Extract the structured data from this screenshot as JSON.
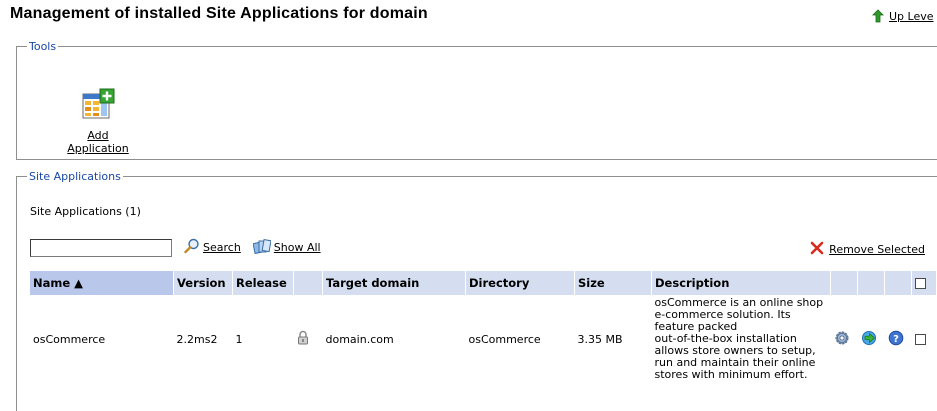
{
  "page": {
    "title": "Management of installed Site Applications for domain",
    "up_level": "Up Leve"
  },
  "tools": {
    "legend": "Tools",
    "add_application": "Add Application"
  },
  "site_apps": {
    "legend": "Site Applications",
    "count_label": "Site Applications (1)",
    "search_value": "",
    "search_label": "Search",
    "show_all_label": "Show All",
    "remove_selected_label": "Remove Selected",
    "columns": {
      "name": "Name ▲",
      "version": "Version",
      "release": "Release",
      "target_domain": "Target domain",
      "directory": "Directory",
      "size": "Size",
      "description": "Description"
    },
    "rows": [
      {
        "name": "osCommerce",
        "version": "2.2ms2",
        "release": "1",
        "target_domain": "domain.com",
        "directory": "osCommerce",
        "size": "3.35 MB",
        "description_lines": [
          "osCommerce is an online shop",
          "e-commerce solution. Its",
          "feature packed",
          "out-of-the-box installation",
          "allows store owners to setup,",
          "run and maintain their online",
          "stores with minimum effort."
        ]
      }
    ]
  },
  "icons": {
    "up_level": "green-up-arrow-icon",
    "add_application": "add-application-icon",
    "search": "magnifier-icon",
    "show_all": "show-all-icon",
    "remove": "red-x-icon",
    "lock": "lock-icon",
    "settings": "gear-icon",
    "login": "go-arrow-icon",
    "help": "help-icon"
  },
  "colors": {
    "legend_text": "#1a47a8",
    "header_bg": "#d5def0",
    "sorted_header_bg": "#b8c7ea",
    "remove_icon": "#d62a1c",
    "up_arrow": "#2f9a2a"
  }
}
